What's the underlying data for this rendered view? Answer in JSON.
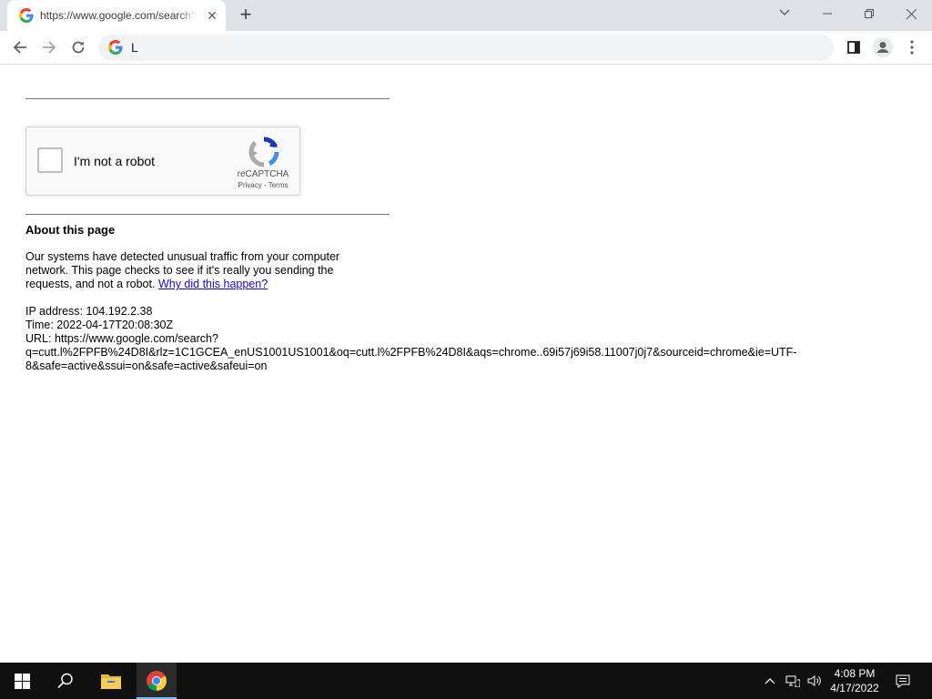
{
  "browser": {
    "tab_title": "https://www.google.com/search?q=cutt.l",
    "tab_close": "✕",
    "new_tab": "+",
    "omnibox_text": "L",
    "favicon": "google-g-icon"
  },
  "window_controls": [
    "tab-search-icon",
    "minimize-icon",
    "restore-icon",
    "close-icon"
  ],
  "toolbar": {
    "icons": [
      "back-arrow-icon",
      "forward-arrow-icon",
      "reload-icon",
      "side-panel-icon",
      "profile-icon",
      "menu-dots-icon"
    ]
  },
  "recaptcha": {
    "label": "I'm not a robot",
    "brand": "reCAPTCHA",
    "privacy": "Privacy",
    "separator": " - ",
    "terms": "Terms"
  },
  "about": {
    "heading": "About this page",
    "text": "Our systems have detected unusual traffic from your computer network. This page checks to see if it's really you sending the requests, and not a robot. ",
    "link": "Why did this happen?"
  },
  "info": {
    "ip": "IP address: 104.192.2.38",
    "time": "Time: 2022-04-17T20:08:30Z",
    "url_line1": "URL: https://www.google.com/search?",
    "url_line2": "q=cutt.l%2FPFB%24D8I&rlz=1C1GCEA_enUS1001US1001&oq=cutt.l%2FPFB%24D8I&aqs=chrome..69i57j69i58.11007j0j7&sourceid=chrome&ie=UTF-",
    "url_line3": "8&safe=active&ssui=on&safe=active&safeui=on"
  },
  "taskbar": {
    "time": "4:08 PM",
    "date": "4/17/2022",
    "icons": [
      "windows-start-icon",
      "search-icon",
      "file-explorer-icon",
      "chrome-icon",
      "chevron-up-icon",
      "network-icon",
      "volume-icon",
      "notifications-icon"
    ]
  }
}
